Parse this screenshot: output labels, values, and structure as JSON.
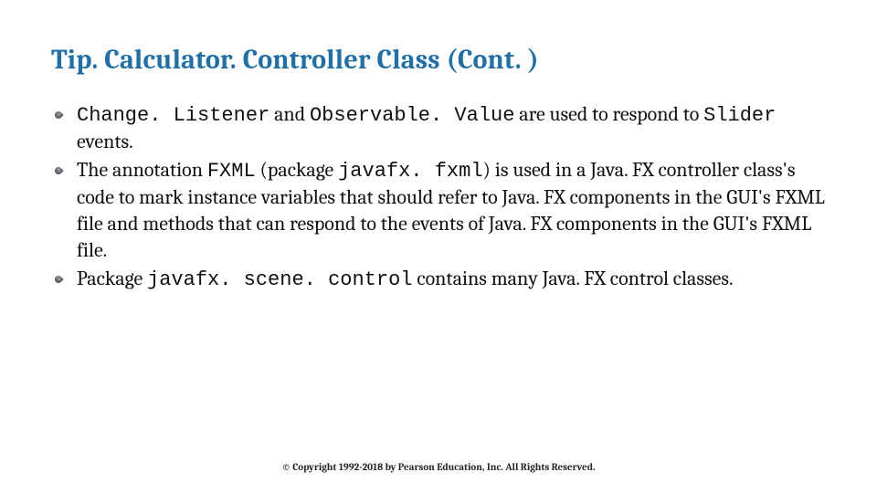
{
  "title": "Tip. Calculator. Controller Class (Cont. )",
  "bullets": [
    {
      "segments": [
        {
          "text": "Change. Listener",
          "mono": true
        },
        {
          "text": " and ",
          "mono": false
        },
        {
          "text": "Observable. Value",
          "mono": true
        },
        {
          "text": " are used to respond to ",
          "mono": false
        },
        {
          "text": "Slider",
          "mono": true
        },
        {
          "text": " events.",
          "mono": false
        }
      ]
    },
    {
      "segments": [
        {
          "text": "The annotation ",
          "mono": false
        },
        {
          "text": "FXML",
          "mono": true
        },
        {
          "text": " (package ",
          "mono": false
        },
        {
          "text": "javafx. fxml",
          "mono": true
        },
        {
          "text": ") is used in a Java. FX controller class's code to mark instance variables that should refer to Java. FX components in the GUI's FXML file and methods that can respond to the events of Java. FX components in the GUI's FXML file.",
          "mono": false
        }
      ]
    },
    {
      "segments": [
        {
          "text": "Package ",
          "mono": false
        },
        {
          "text": "javafx. scene. control",
          "mono": true
        },
        {
          "text": " contains many Java. FX control classes.",
          "mono": false
        }
      ]
    }
  ],
  "footer": "© Copyright 1992-2018 by Pearson Education, Inc. All Rights Reserved."
}
